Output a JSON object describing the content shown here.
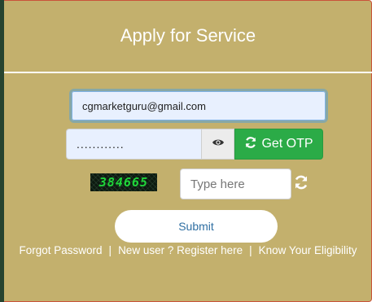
{
  "form": {
    "title": "Apply for Service",
    "email_value": "cgmarketguru@gmail.com",
    "password_value": "............",
    "get_otp_label": "Get OTP",
    "captcha_text": "384665",
    "captcha_placeholder": "Type here",
    "submit_label": "Submit"
  },
  "footer": {
    "forgot_password": "Forgot Password",
    "register": "New user ? Register here",
    "eligibility": "Know Your Eligibility",
    "separator": "|"
  },
  "colors": {
    "panel_bg": "#c3b06d",
    "otp_button": "#2bab47",
    "captcha_text": "#1fd63a",
    "submit_text": "#2f6fa2"
  },
  "icons": {
    "eye": "eye-icon",
    "otp": "refresh-icon",
    "captcha_refresh": "refresh-icon"
  }
}
